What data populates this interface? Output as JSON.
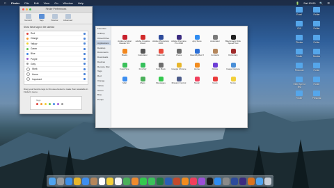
{
  "menubar": {
    "items": [
      "Finder",
      "File",
      "Edit",
      "View",
      "Go",
      "Window",
      "Help"
    ],
    "right": [
      "🔋",
      "Sat 10:00",
      "🔍",
      "☰"
    ]
  },
  "prefs": {
    "title": "Finder Preferences",
    "tabs": [
      "General",
      "Tags",
      "Sidebar",
      "Advanced"
    ],
    "active_tab": "Tags",
    "hint": "Show these tags in the sidebar:",
    "tags": [
      {
        "name": "Red",
        "color": "#e0433b"
      },
      {
        "name": "Orange",
        "color": "#f29a2e"
      },
      {
        "name": "Yellow",
        "color": "#f2cf2e"
      },
      {
        "name": "Green",
        "color": "#5cc552"
      },
      {
        "name": "Blue",
        "color": "#3f86e5"
      },
      {
        "name": "Purple",
        "color": "#a05ed3"
      },
      {
        "name": "Gray",
        "color": "#9a9a9a"
      },
      {
        "name": "Work",
        "color": "#ffffff"
      },
      {
        "name": "Home",
        "color": "#ffffff"
      },
      {
        "name": "Important",
        "color": "#ffffff"
      }
    ],
    "fav_hint": "Drag your favorite tags to this area below to make them available in Finder's menu.",
    "fav_label": "Tags",
    "fav_colors": [
      "#e0433b",
      "#f29a2e",
      "#f2cf2e",
      "#5cc552",
      "#3f86e5",
      "#a05ed3",
      "#9a9a9a"
    ]
  },
  "finder": {
    "sidebar": [
      "Favorites",
      "AirDrop",
      "iCloud Drive",
      "Applications",
      "Desktop",
      "Documents",
      "Downloads",
      "Devices",
      "Remote Disc",
      "Tags",
      "Red",
      "Orange",
      "Yellow",
      "Green",
      "Blue",
      "Purple"
    ],
    "selected": "Applications",
    "apps": [
      {
        "name": "Adobe Acrobat Reader DC",
        "color": "#c8202c"
      },
      {
        "name": "Adobe Creative Cloud",
        "color": "#d12a2a"
      },
      {
        "name": "Adobe Photoshop 2020",
        "color": "#2d4b9b"
      },
      {
        "name": "Adobe Premiere Pro 2020",
        "color": "#3b2b80"
      },
      {
        "name": "App Store",
        "color": "#2f8cf1"
      },
      {
        "name": "Automator",
        "color": "#7a7a7a"
      },
      {
        "name": "Blackmagic Disk Speed Test",
        "color": "#202020"
      },
      {
        "name": "Books",
        "color": "#f2871e"
      },
      {
        "name": "Calculator",
        "color": "#555555"
      },
      {
        "name": "Calendar",
        "color": "#e84a3c"
      },
      {
        "name": "Chess",
        "color": "#6b6b6b"
      },
      {
        "name": "CleanMyMac X",
        "color": "#2c6fd6"
      },
      {
        "name": "Contacts",
        "color": "#b4865b"
      },
      {
        "name": "Dictionary",
        "color": "#9e2a2a"
      },
      {
        "name": "FaceTime",
        "color": "#3ac15a"
      },
      {
        "name": "Find My",
        "color": "#35c05b"
      },
      {
        "name": "Font Book",
        "color": "#6e6e6e"
      },
      {
        "name": "Google Chrome",
        "color": "#e8b62b"
      },
      {
        "name": "Home",
        "color": "#f28c1e"
      },
      {
        "name": "iMovie",
        "color": "#6d3ed6"
      },
      {
        "name": "Image Capture",
        "color": "#4a8fd8"
      },
      {
        "name": "Mail",
        "color": "#3d8ef0"
      },
      {
        "name": "Maps",
        "color": "#4ab05a"
      },
      {
        "name": "Messages",
        "color": "#34c84e"
      },
      {
        "name": "Mission Control",
        "color": "#4b5b8a"
      },
      {
        "name": "Music",
        "color": "#f03f5c"
      },
      {
        "name": "News",
        "color": "#ea3b3b"
      },
      {
        "name": "Notes",
        "color": "#f2cf3a"
      }
    ]
  },
  "desktop": {
    "icons": [
      "Folder",
      "Excel",
      "Folder",
      "GUI",
      "Folder",
      "Photos",
      "Movies",
      "Folder",
      "Folder",
      "Personal",
      "Folder",
      "HDD Speed Test",
      "Personal",
      "Folder"
    ]
  },
  "dock": {
    "icons": [
      {
        "name": "finder",
        "color": "#4fa3ee"
      },
      {
        "name": "launchpad",
        "color": "#9a9a9a"
      },
      {
        "name": "safari",
        "color": "#3b8ee8"
      },
      {
        "name": "chrome",
        "color": "#e8b62b"
      },
      {
        "name": "mail",
        "color": "#3d8ef0"
      },
      {
        "name": "contacts",
        "color": "#b4865b"
      },
      {
        "name": "calendar",
        "color": "#ffffff"
      },
      {
        "name": "notes",
        "color": "#f2cf3a"
      },
      {
        "name": "reminders",
        "color": "#f6f6f6"
      },
      {
        "name": "maps",
        "color": "#4ab05a"
      },
      {
        "name": "photos",
        "color": "#f08a2e"
      },
      {
        "name": "messages",
        "color": "#34c84e"
      },
      {
        "name": "facetime",
        "color": "#3ac15a"
      },
      {
        "name": "excel",
        "color": "#1f7a41"
      },
      {
        "name": "word",
        "color": "#2b5fb3"
      },
      {
        "name": "powerpoint",
        "color": "#c34a2c"
      },
      {
        "name": "vlc",
        "color": "#f28c1e"
      },
      {
        "name": "music",
        "color": "#f03f5c"
      },
      {
        "name": "podcasts",
        "color": "#9b4fd6"
      },
      {
        "name": "tv",
        "color": "#1a1a1a"
      },
      {
        "name": "app-store",
        "color": "#2f8cf1"
      },
      {
        "name": "system-preferences",
        "color": "#8a8a8a"
      },
      {
        "name": "photoshop",
        "color": "#2d4b9b"
      },
      {
        "name": "premiere",
        "color": "#3b2b80"
      },
      {
        "name": "illustrator",
        "color": "#d9731e"
      },
      {
        "name": "downloads",
        "color": "#4fa3ee"
      },
      {
        "name": "trash",
        "color": "#c9ced6"
      }
    ]
  }
}
